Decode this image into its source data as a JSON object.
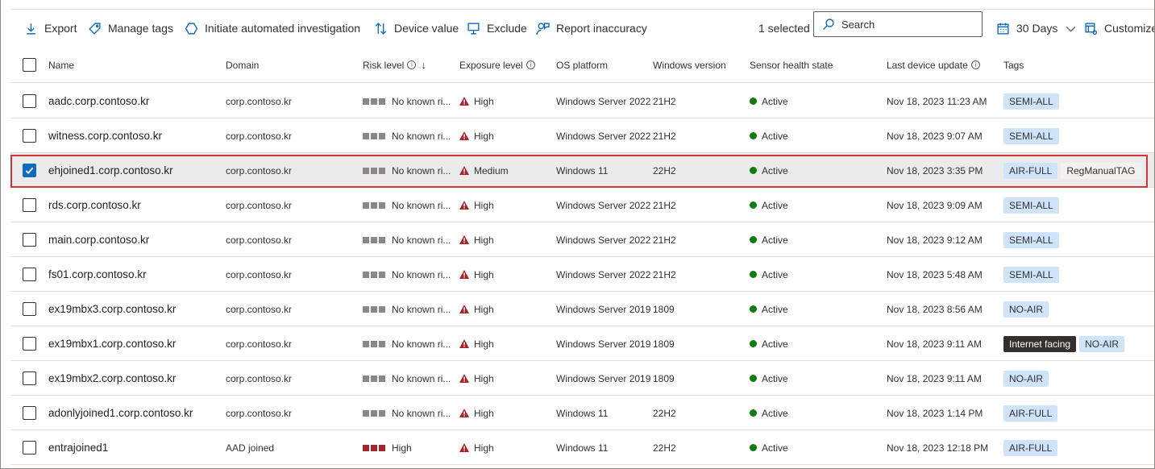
{
  "toolbar": {
    "export": "Export",
    "manage_tags": "Manage tags",
    "investigate": "Initiate automated investigation",
    "device_value": "Device value",
    "exclude": "Exclude",
    "report": "Report inaccuracy",
    "selected_count": "1 selected",
    "search_placeholder": "Search",
    "time_range": "30 Days",
    "customize": "Customize"
  },
  "columns": {
    "name": "Name",
    "domain": "Domain",
    "risk": "Risk level",
    "exposure": "Exposure level",
    "os": "OS platform",
    "winver": "Windows version",
    "sensor": "Sensor health state",
    "update": "Last device update",
    "tags": "Tags"
  },
  "colors": {
    "accent": "#0f6cbd",
    "risk_high": "#a4262c",
    "active": "#107c10",
    "selection_outline": "#d13438"
  },
  "rows": [
    {
      "name": "aadc.corp.contoso.kr",
      "domain": "corp.contoso.kr",
      "risk": "No known ri...",
      "risk_high": false,
      "exposure": "High",
      "os": "Windows Server 2022",
      "winver": "21H2",
      "sensor": "Active",
      "update": "Nov 18, 2023 11:23 AM",
      "tags": [
        {
          "label": "SEMI-ALL",
          "style": "blue"
        }
      ],
      "selected": false
    },
    {
      "name": "witness.corp.contoso.kr",
      "domain": "corp.contoso.kr",
      "risk": "No known ri...",
      "risk_high": false,
      "exposure": "High",
      "os": "Windows Server 2022",
      "winver": "21H2",
      "sensor": "Active",
      "update": "Nov 18, 2023 9:07 AM",
      "tags": [
        {
          "label": "SEMI-ALL",
          "style": "blue"
        }
      ],
      "selected": false
    },
    {
      "name": "ehjoined1.corp.contoso.kr",
      "domain": "corp.contoso.kr",
      "risk": "No known ri...",
      "risk_high": false,
      "exposure": "Medium",
      "os": "Windows 11",
      "winver": "22H2",
      "sensor": "Active",
      "update": "Nov 18, 2023 3:35 PM",
      "tags": [
        {
          "label": "AIR-FULL",
          "style": "blue"
        },
        {
          "label": "RegManualTAG",
          "style": "gray"
        }
      ],
      "selected": true
    },
    {
      "name": "rds.corp.contoso.kr",
      "domain": "corp.contoso.kr",
      "risk": "No known ri...",
      "risk_high": false,
      "exposure": "High",
      "os": "Windows Server 2022",
      "winver": "21H2",
      "sensor": "Active",
      "update": "Nov 18, 2023 9:09 AM",
      "tags": [
        {
          "label": "SEMI-ALL",
          "style": "blue"
        }
      ],
      "selected": false
    },
    {
      "name": "main.corp.contoso.kr",
      "domain": "corp.contoso.kr",
      "risk": "No known ri...",
      "risk_high": false,
      "exposure": "High",
      "os": "Windows Server 2022",
      "winver": "21H2",
      "sensor": "Active",
      "update": "Nov 18, 2023 9:12 AM",
      "tags": [
        {
          "label": "SEMI-ALL",
          "style": "blue"
        }
      ],
      "selected": false
    },
    {
      "name": "fs01.corp.contoso.kr",
      "domain": "corp.contoso.kr",
      "risk": "No known ri...",
      "risk_high": false,
      "exposure": "High",
      "os": "Windows Server 2022",
      "winver": "21H2",
      "sensor": "Active",
      "update": "Nov 18, 2023 5:48 AM",
      "tags": [
        {
          "label": "SEMI-ALL",
          "style": "blue"
        }
      ],
      "selected": false
    },
    {
      "name": "ex19mbx3.corp.contoso.kr",
      "domain": "corp.contoso.kr",
      "risk": "No known ri...",
      "risk_high": false,
      "exposure": "High",
      "os": "Windows Server 2019",
      "winver": "1809",
      "sensor": "Active",
      "update": "Nov 18, 2023 8:56 AM",
      "tags": [
        {
          "label": "NO-AIR",
          "style": "blue"
        }
      ],
      "selected": false
    },
    {
      "name": "ex19mbx1.corp.contoso.kr",
      "domain": "corp.contoso.kr",
      "risk": "No known ri...",
      "risk_high": false,
      "exposure": "High",
      "os": "Windows Server 2019",
      "winver": "1809",
      "sensor": "Active",
      "update": "Nov 18, 2023 9:11 AM",
      "tags": [
        {
          "label": "Internet facing",
          "style": "dark"
        },
        {
          "label": "NO-AIR",
          "style": "blue"
        }
      ],
      "selected": false
    },
    {
      "name": "ex19mbx2.corp.contoso.kr",
      "domain": "corp.contoso.kr",
      "risk": "No known ri...",
      "risk_high": false,
      "exposure": "High",
      "os": "Windows Server 2019",
      "winver": "1809",
      "sensor": "Active",
      "update": "Nov 18, 2023 9:11 AM",
      "tags": [
        {
          "label": "NO-AIR",
          "style": "blue"
        }
      ],
      "selected": false
    },
    {
      "name": "adonlyjoined1.corp.contoso.kr",
      "domain": "corp.contoso.kr",
      "risk": "No known ri...",
      "risk_high": false,
      "exposure": "High",
      "os": "Windows 11",
      "winver": "22H2",
      "sensor": "Active",
      "update": "Nov 18, 2023 1:14 PM",
      "tags": [
        {
          "label": "AIR-FULL",
          "style": "blue"
        }
      ],
      "selected": false
    },
    {
      "name": "entrajoined1",
      "domain": "AAD joined",
      "risk": "High",
      "risk_high": true,
      "exposure": "High",
      "os": "Windows 11",
      "winver": "22H2",
      "sensor": "Active",
      "update": "Nov 18, 2023 12:18 PM",
      "tags": [
        {
          "label": "AIR-FULL",
          "style": "blue"
        }
      ],
      "selected": false
    }
  ]
}
